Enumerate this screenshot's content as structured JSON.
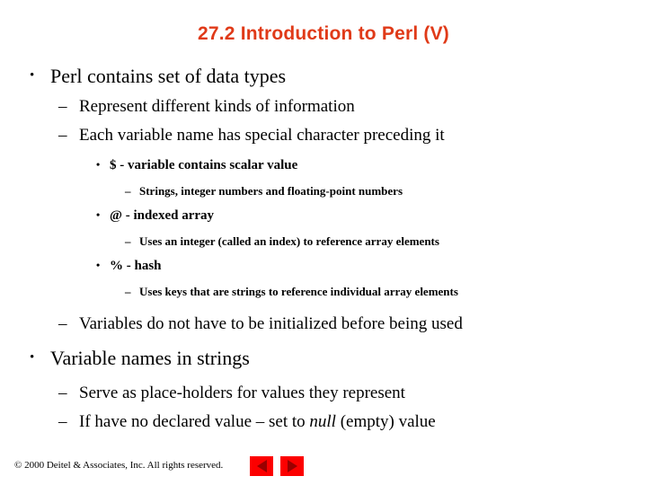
{
  "slide": {
    "title": "27.2 Introduction to Perl (V)",
    "title_color": "#e03a18",
    "background_color": "#ffffff",
    "text_color": "#000000"
  },
  "bullets": [
    {
      "level": 1,
      "marker": "•",
      "text": "Perl contains set of data types"
    },
    {
      "level": 2,
      "marker": "–",
      "text": "Represent different kinds of information"
    },
    {
      "level": 2,
      "marker": "–",
      "text": "Each variable name has special character preceding it"
    },
    {
      "level": 3,
      "marker": "•",
      "text": "$ - variable contains scalar value"
    },
    {
      "level": 4,
      "marker": "–",
      "text": "Strings, integer numbers and floating-point numbers"
    },
    {
      "level": 3,
      "marker": "•",
      "text": "@ - indexed array"
    },
    {
      "level": 4,
      "marker": "–",
      "text": "Uses an integer (called an index) to reference array elements"
    },
    {
      "level": 3,
      "marker": "•",
      "text": "% - hash"
    },
    {
      "level": 4,
      "marker": "–",
      "text": "Uses keys that are strings to reference individual array elements"
    },
    {
      "level": 2,
      "marker": "–",
      "text": "Variables do not have to be initialized before being used"
    },
    {
      "level": 1,
      "marker": "•",
      "text": "Variable names in strings"
    },
    {
      "level": 2,
      "marker": "–",
      "text": "Serve as place-holders for values they represent"
    },
    {
      "level": 2,
      "marker": "–",
      "text_before_italic": "If have no declared value – set to ",
      "italic_word": "null",
      "text_after_italic": " (empty) value"
    }
  ],
  "footer": {
    "copyright": "© 2000 Deitel & Associates, Inc.  All rights reserved.",
    "previous_button_icon": "triangle-left-icon",
    "next_button_icon": "triangle-right-icon",
    "button_color": "#fc0000",
    "button_glyph_color": "#9a0000"
  }
}
